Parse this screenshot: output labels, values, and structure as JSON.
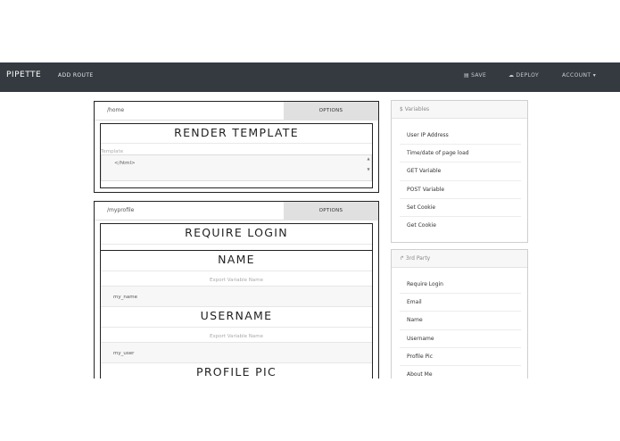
{
  "nav": {
    "brand": "PIPETTE",
    "add_route": "ADD ROUTE",
    "save": "SAVE",
    "deploy": "DEPLOY",
    "account": "ACCOUNT ▾",
    "save_icon": "floppy-icon",
    "deploy_icon": "cloud-upload-icon"
  },
  "routes": [
    {
      "path": "/home",
      "options": "OPTIONS",
      "blocks": [
        {
          "title": "RENDER TEMPLATE",
          "field_label": "Template",
          "value": "</html>"
        }
      ]
    },
    {
      "path": "/myprofile",
      "options": "OPTIONS",
      "blocks": [
        {
          "title": "REQUIRE LOGIN"
        },
        {
          "title": "NAME",
          "field_label": "Export Variable Name",
          "value": "my_name"
        },
        {
          "title": "USERNAME",
          "field_label": "Export Variable Name",
          "value": "my_user"
        },
        {
          "title": "PROFILE PIC"
        }
      ]
    }
  ],
  "variables_panel": {
    "header": "$ Variables",
    "items": [
      "User IP Address",
      "Time/date of page load",
      "GET Variable",
      "POST Variable",
      "Set Cookie",
      "Get Cookie"
    ]
  },
  "third_party_panel": {
    "header": "↱ 3rd Party",
    "items": [
      "Require Login",
      "Email",
      "Name",
      "Username",
      "Profile Pic",
      "About Me"
    ]
  }
}
